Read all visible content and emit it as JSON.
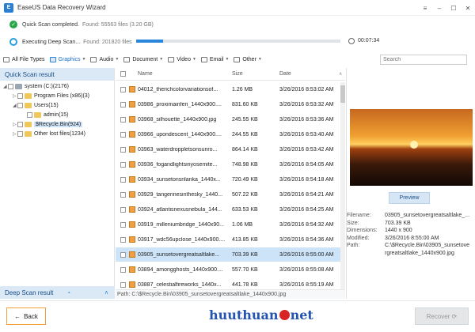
{
  "window": {
    "title": "EaseUS Data Recovery Wizard",
    "controls": [
      "≡",
      "–",
      "☐",
      "✕"
    ]
  },
  "scan": {
    "quick_label": "Quick Scan completed.",
    "quick_detail": "Found: 55563 files (3.20 GB)",
    "deep_label": "Executing Deep Scan...",
    "deep_detail": "Found: 201820 files",
    "progress": 0.13,
    "timer": "00:07:34",
    "progress_color": "#2a86d8"
  },
  "filters": [
    {
      "label": "All File Types",
      "icon": "all-files-icon",
      "caret": false,
      "active": false
    },
    {
      "label": "Graphics",
      "icon": "graphics-icon",
      "caret": true,
      "active": true
    },
    {
      "label": "Audio",
      "icon": "audio-icon",
      "caret": true,
      "active": false
    },
    {
      "label": "Document",
      "icon": "document-icon",
      "caret": true,
      "active": false
    },
    {
      "label": "Video",
      "icon": "video-icon",
      "caret": true,
      "active": false
    },
    {
      "label": "Email",
      "icon": "email-icon",
      "caret": true,
      "active": false
    },
    {
      "label": "Other",
      "icon": "other-icon",
      "caret": true,
      "active": false
    }
  ],
  "search": {
    "placeholder": "Search"
  },
  "tree": {
    "header": "Quick Scan result",
    "items": [
      {
        "label": "system (C:)(2176)",
        "level": 0,
        "caret": "◢",
        "icon": "drive",
        "selected": false
      },
      {
        "label": "Program Files (x86)(3)",
        "level": 1,
        "caret": "▷",
        "icon": "folder",
        "selected": false
      },
      {
        "label": "Users(15)",
        "level": 1,
        "caret": "◢",
        "icon": "folder",
        "selected": false
      },
      {
        "label": "admin(15)",
        "level": 2,
        "caret": "",
        "icon": "folder",
        "selected": false
      },
      {
        "label": "$Recycle.Bin(924)",
        "level": 1,
        "caret": "▷",
        "icon": "folder",
        "selected": true
      },
      {
        "label": "Other lost files(1234)",
        "level": 1,
        "caret": "▷",
        "icon": "folder",
        "selected": false
      }
    ],
    "deep_header": "Deep Scan result",
    "deep_caret": "∧"
  },
  "list": {
    "columns": {
      "name": "Name",
      "size": "Size",
      "date": "Date"
    },
    "sort_indicator": "∧",
    "rows": [
      {
        "name": "04012_therichcolorvariationsof...",
        "size": "1.26 MB",
        "date": "3/26/2016 8:53:02 AM",
        "selected": false
      },
      {
        "name": "03986_proximainferi_1440x900....",
        "size": "831.60 KB",
        "date": "3/26/2016 8:53:32 AM",
        "selected": false
      },
      {
        "name": "03968_silhouette_1440x900.jpg",
        "size": "245.55 KB",
        "date": "3/26/2016 8:53:36 AM",
        "selected": false
      },
      {
        "name": "03966_upondescent_1440x900....",
        "size": "244.55 KB",
        "date": "3/26/2016 8:53:40 AM",
        "selected": false
      },
      {
        "name": "03963_waterdroppletsonsunro...",
        "size": "864.14 KB",
        "date": "3/26/2016 8:53:42 AM",
        "selected": false
      },
      {
        "name": "03936_fogandlightsinyosemite...",
        "size": "748.98 KB",
        "date": "3/26/2016 8:54:05 AM",
        "selected": false
      },
      {
        "name": "03934_sunsetonsrilanka_1440x...",
        "size": "720.49 KB",
        "date": "3/26/2016 8:54:18 AM",
        "selected": false
      },
      {
        "name": "03929_tangerinesinthesky_1440...",
        "size": "507.22 KB",
        "date": "3/26/2016 8:54:21 AM",
        "selected": false
      },
      {
        "name": "03924_atlantisnexusnebula_144...",
        "size": "633.53 KB",
        "date": "3/26/2016 8:54:25 AM",
        "selected": false
      },
      {
        "name": "03919_milleniumbridge_1440x90...",
        "size": "1.06 MB",
        "date": "3/26/2016 8:54:32 AM",
        "selected": false
      },
      {
        "name": "03917_wdc56upclose_1440x900....",
        "size": "413.85 KB",
        "date": "3/26/2016 8:54:36 AM",
        "selected": false
      },
      {
        "name": "03905_sunsetovergreatsaltlake...",
        "size": "703.39 KB",
        "date": "3/26/2016 8:55:00 AM",
        "selected": true
      },
      {
        "name": "03894_amongghosts_1440x900....",
        "size": "557.70 KB",
        "date": "3/26/2016 8:55:08 AM",
        "selected": false
      },
      {
        "name": "03887_celestialfireworks_1440x...",
        "size": "441.78 KB",
        "date": "3/26/2016 8:55:19 AM",
        "selected": false
      }
    ]
  },
  "preview": {
    "button": "Preview",
    "info": [
      {
        "key": "Filename:",
        "value": "03905_sunsetovergreatsaltlake_..."
      },
      {
        "key": "Size:",
        "value": "703.39 KB"
      },
      {
        "key": "Dimensions:",
        "value": "1440 x 900"
      },
      {
        "key": "Modified:",
        "value": "3/26/2016 8:55:00 AM"
      },
      {
        "key": "Path:",
        "value": "C:\\$Recycle.Bin\\03905_sunsetove"
      },
      {
        "key": "",
        "value": "rgreatsaltlake_1440x900.jpg"
      }
    ]
  },
  "path_bar": {
    "label": "Path:",
    "value": "C:\\$Recycle.Bin\\03905_sunsetovergreatsaltlake_1440x900.jpg"
  },
  "buttons": {
    "back": "Back",
    "back_arrow": "←",
    "recover": "Recover",
    "recover_arrow": "⟳"
  },
  "watermark": {
    "part1": "huuthuan",
    "part2": "net"
  }
}
